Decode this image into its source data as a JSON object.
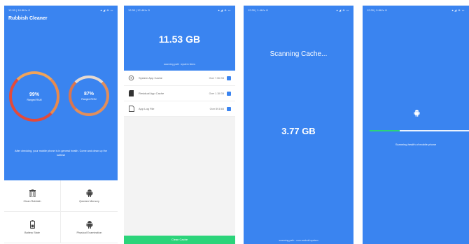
{
  "phone1": {
    "status_left": "12:30 | 18.8K/s ⊙",
    "status_right": "▲◢ ⊕ ▭",
    "app_title": "Rubbish Cleaner",
    "ram": {
      "percent": "99%",
      "label": "Ranged RAM",
      "level": 0.99
    },
    "rom": {
      "percent": "87%",
      "label": "Ranged ROM",
      "level": 0.87
    },
    "hint": "After checking, your mobile phone is in general health. Come and clean up the rubbish",
    "tiles": [
      {
        "label": "Clean Rubbish",
        "icon": "trash-icon"
      },
      {
        "label": "Quicken Memory",
        "icon": "android-icon"
      },
      {
        "label": "Battery State",
        "icon": "battery-icon"
      },
      {
        "label": "Physical Examination",
        "icon": "android-icon"
      }
    ]
  },
  "phone2": {
    "status_left": "12:30 | 12.4K/s ⊙",
    "status_right": "▲◢ ⊕ ▭",
    "size": "11.53 GB",
    "path": "scanning path : system items",
    "items": [
      {
        "name": "System App Cache",
        "size": "Over 7.06 GB",
        "icon": "gear-icon"
      },
      {
        "name": "Residual App Cache",
        "size": "Over 1.18 GB",
        "icon": "sd-card-icon"
      },
      {
        "name": "App Log File",
        "size": "Over 89.8 kB",
        "icon": "file-icon"
      }
    ],
    "button": "Clean Cache"
  },
  "phone3": {
    "status_left": "12:30 | 1.4K/s ⊙",
    "status_right": "▲◢ ⊕ ▭",
    "scan_title": "Scanning Cache...",
    "size": "3.77 GB",
    "footer": "scanning path : com.android.system"
  },
  "phone4": {
    "status_left": "12:30 | 0.8K/s ⊙",
    "status_right": "▲◢ ⊕ ▭",
    "progress": 0.3,
    "text": "Scanning health of mobile phone"
  },
  "colors": {
    "primary": "#3a84f0",
    "accent_green": "#2bd47a",
    "ring_red": "#e24a3b",
    "ring_orange": "#f0a35a"
  }
}
